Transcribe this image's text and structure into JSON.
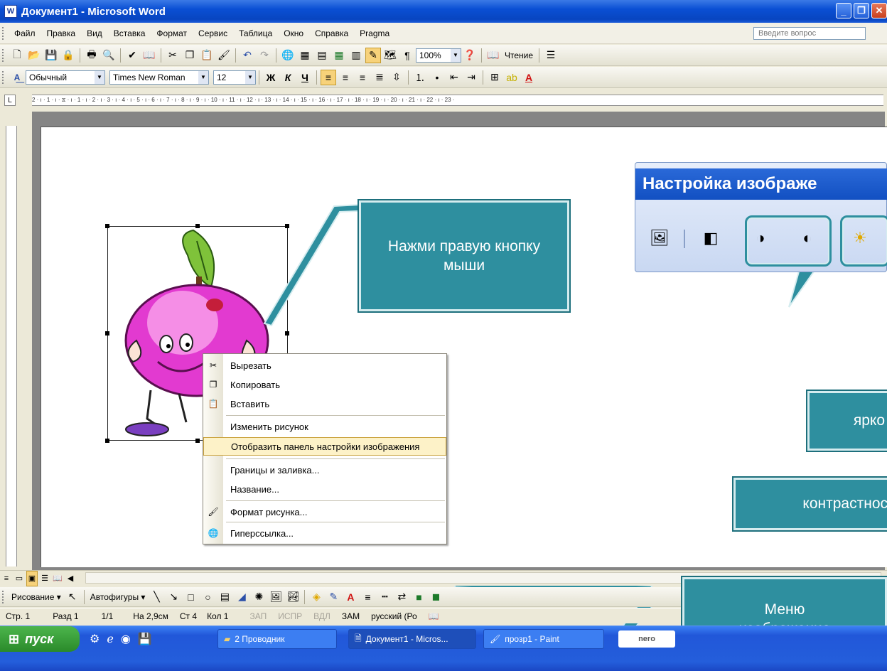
{
  "window": {
    "title": "Документ1 - Microsoft Word",
    "app_icon": "W"
  },
  "menubar": {
    "items": [
      "Файл",
      "Правка",
      "Вид",
      "Вставка",
      "Формат",
      "Сервис",
      "Таблица",
      "Окно",
      "Справка",
      "Pragma"
    ],
    "ask_placeholder": "Введите вопрос"
  },
  "toolbar_standard": {
    "zoom": "100%",
    "reading": "Чтение"
  },
  "toolbar_format": {
    "style": "Обычный",
    "font": "Times New Roman",
    "size": "12",
    "bold": "Ж",
    "italic": "К",
    "underline": "Ч"
  },
  "ruler": {
    "marks": "2 · ı · 1 · ı · ⧖ · ı · 1 · ı · 2 · ı · 3 · ı · 4 · ı · 5 · ı · 6 · ı · 7 · ı · 8 · ı · 9 · ı · 10 · ı · 11 · ı · 12 · ı · 13 · ı · 14 · ı · 15 · ı · 16 · ı · 17 · ı · 18 · ı · 19 · ı · 20 · ı · 21 · ı · 22 · ı · 23 ·",
    "tab": "L"
  },
  "context_menu": {
    "items": [
      {
        "label": "Вырезать",
        "icon": "scissors-icon",
        "glyph": "✂"
      },
      {
        "label": "Копировать",
        "icon": "copy-icon",
        "glyph": "❐"
      },
      {
        "label": "Вставить",
        "icon": "paste-icon",
        "glyph": "📋"
      },
      {
        "label": "Изменить рисунок",
        "icon": "",
        "glyph": ""
      },
      {
        "label": "Отобразить панель настройки изображения",
        "icon": "",
        "glyph": "",
        "selected": true
      },
      {
        "label": "Границы и заливка...",
        "icon": "",
        "glyph": ""
      },
      {
        "label": "Название...",
        "icon": "",
        "glyph": ""
      },
      {
        "label": "Формат рисунка...",
        "icon": "format-picture-icon",
        "glyph": "🖌"
      },
      {
        "label": "Гиперссылка...",
        "icon": "hyperlink-icon",
        "glyph": "🌐"
      }
    ]
  },
  "callouts": {
    "right_click": "Нажми правую кнопку мыши",
    "brightness": "ярко",
    "contrast": "контрастнос",
    "image_menu_line1": "Меню",
    "image_menu_line2": "«изображение»"
  },
  "picture_toolbar": {
    "title": "Настройка изображе"
  },
  "drawbar": {
    "drawing": "Рисование ▾",
    "autoshapes": "Автофигуры ▾"
  },
  "statusbar": {
    "page": "Стр. 1",
    "section": "Разд 1",
    "pages": "1/1",
    "at": "На 2,9см",
    "line": "Ст 4",
    "col": "Кол 1",
    "rec": "ЗАП",
    "trk": "ИСПР",
    "ext": "ВДЛ",
    "ovr": "ЗАМ",
    "lang": "русский (Ро"
  },
  "taskbar": {
    "start": "пуск",
    "tasks": [
      "2 Проводник",
      "Документ1 - Micros...",
      "прозр1 - Paint"
    ],
    "tray": "nero"
  },
  "colors": {
    "callout_bg": "#2e8f9f",
    "title_blue": "#0a4fd4",
    "start_green": "#2a8a2a"
  }
}
